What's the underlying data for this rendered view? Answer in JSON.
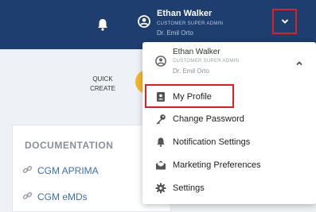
{
  "header": {
    "user_name": "Ethan Walker",
    "user_role": "CUSTOMER SUPER ADMIN",
    "user_org": "Dr. Emil Orto"
  },
  "quick_create": {
    "line1": "QUICK",
    "line2": "CREATE"
  },
  "documentation": {
    "title": "DOCUMENTATION",
    "links": [
      "CGM APRIMA",
      "CGM eMDs"
    ]
  },
  "dropdown": {
    "user_name": "Ethan Walker",
    "user_role": "CUSTOMER SUPER ADMIN",
    "user_org": "Dr. Emil Orto",
    "items": [
      {
        "label": "My Profile",
        "icon": "profile-card-icon"
      },
      {
        "label": "Change Password",
        "icon": "key-icon"
      },
      {
        "label": "Notification Settings",
        "icon": "bell-icon"
      },
      {
        "label": "Marketing Preferences",
        "icon": "envelope-open-icon"
      },
      {
        "label": "Settings",
        "icon": "gear-icon"
      }
    ]
  },
  "colors": {
    "header_bg": "#1d3e6e",
    "highlight": "#e02020",
    "link": "#3a6fb0",
    "quick_create_accent": "#f6b62a"
  }
}
